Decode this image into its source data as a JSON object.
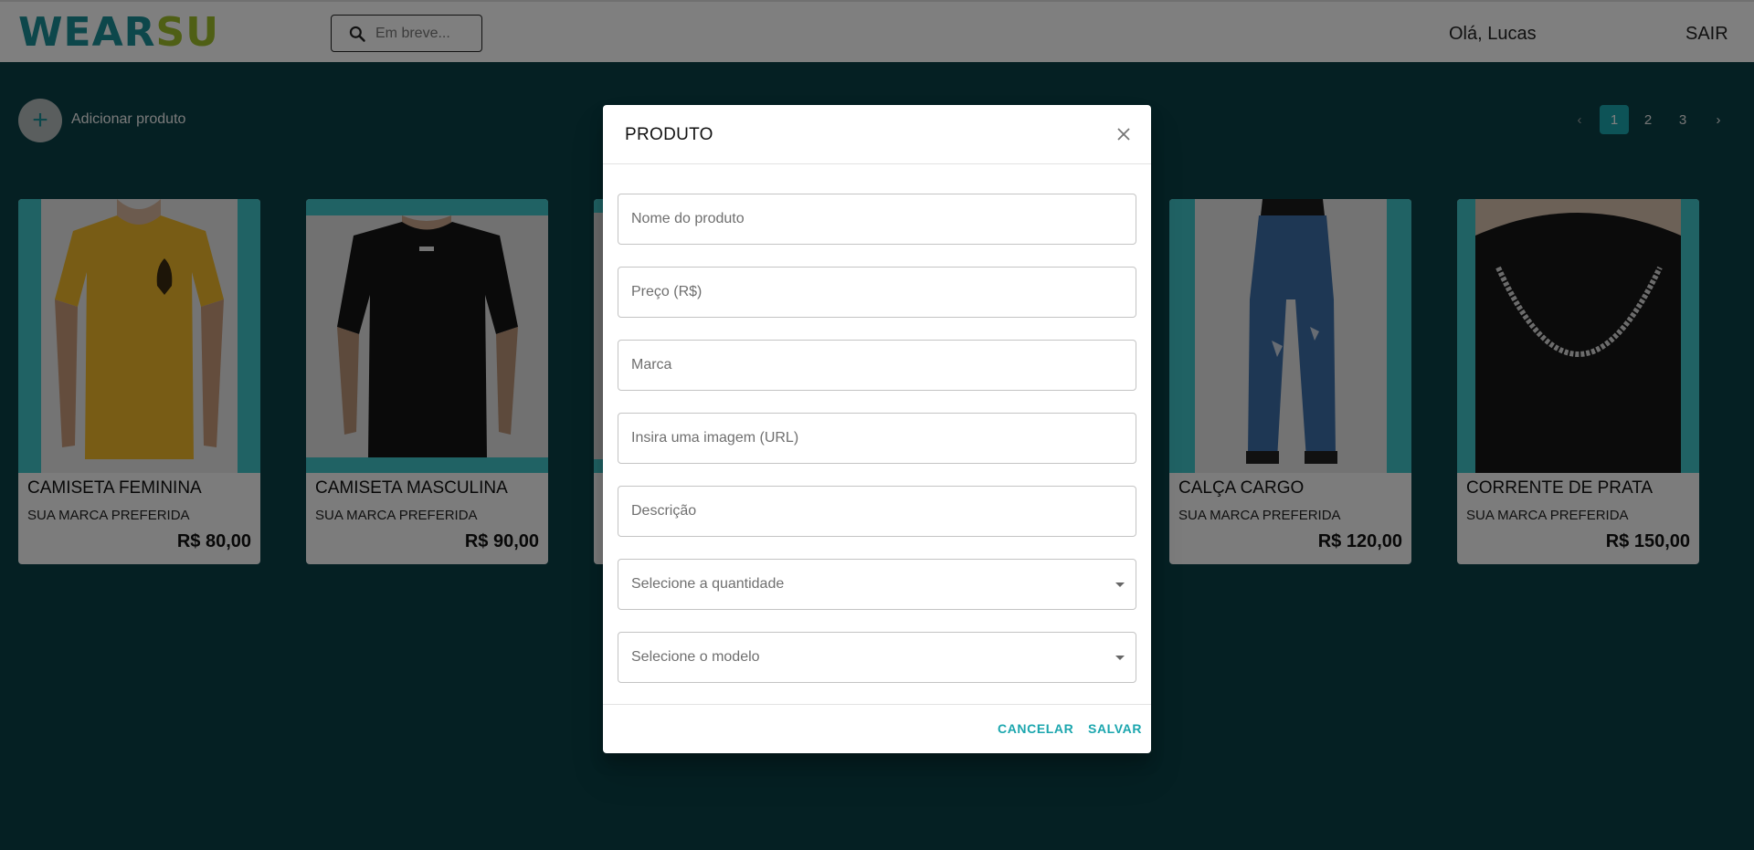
{
  "header": {
    "logo_part1": "WEAR",
    "logo_part2": "SU",
    "search_placeholder": "Em breve...",
    "greeting": "Olá, Lucas",
    "logout_label": "SAIR"
  },
  "toolbar": {
    "add_icon": "+",
    "add_label": "Adicionar produto"
  },
  "pagination": {
    "prev": "‹",
    "pages": [
      "1",
      "2",
      "3"
    ],
    "next": "›",
    "current": "1"
  },
  "products": [
    {
      "name": "CAMISETA FEMININA",
      "brand": "SUA MARCA PREFERIDA",
      "price": "R$ 80,00"
    },
    {
      "name": "CAMISETA MASCULINA",
      "brand": "SUA MARCA PREFERIDA",
      "price": "R$ 90,00"
    },
    {
      "name": "CALÇA CARGO",
      "brand": "SUA MARCA PREFERIDA",
      "price": "R$ 120,00"
    },
    {
      "name": "CORRENTE DE PRATA",
      "brand": "SUA MARCA PREFERIDA",
      "price": "R$ 150,00"
    }
  ],
  "dialog": {
    "title": "PRODUTO",
    "fields": {
      "name": "Nome do produto",
      "price": "Preço (R$)",
      "brand": "Marca",
      "image": "Insira uma imagem (URL)",
      "description": "Descrição"
    },
    "quantity_select": "Selecione a quantidade",
    "model_select": "Selecione o modelo",
    "cancel_label": "CANCELAR",
    "save_label": "SALVAR"
  },
  "colors": {
    "brand_teal": "#1ba6ae",
    "brand_green": "#9fbf2a",
    "page_bg": "#0b4147"
  }
}
